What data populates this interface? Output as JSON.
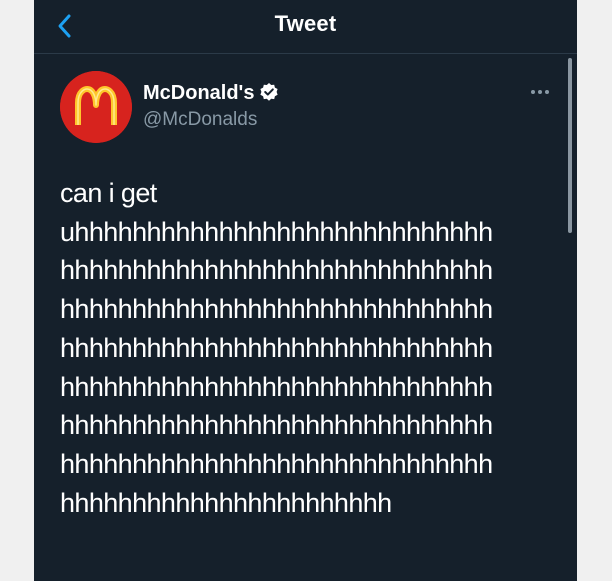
{
  "nav": {
    "title": "Tweet",
    "back_icon": "chevron-left-icon"
  },
  "colors": {
    "background": "#15202b",
    "accent": "#1da1f2",
    "brand_red": "#d7231e",
    "brand_gold": "#ffc72c"
  },
  "tweet": {
    "author_name": "McDonald's",
    "author_handle": "@McDonalds",
    "verified_icon": "verified-badge-icon",
    "more_icon": "more-dots-icon",
    "avatar_icon": "mcdonalds-logo-icon",
    "text": "can i get\nuhhhhhhhhhhhhhhhhhhhhhhhhhhhhh\nhhhhhhhhhhhhhhhhhhhhhhhhhhhhhh\nhhhhhhhhhhhhhhhhhhhhhhhhhhhhhh\nhhhhhhhhhhhhhhhhhhhhhhhhhhhhhh\nhhhhhhhhhhhhhhhhhhhhhhhhhhhhhh\nhhhhhhhhhhhhhhhhhhhhhhhhhhhhhh\nhhhhhhhhhhhhhhhhhhhhhhhhhhhhhh\nhhhhhhhhhhhhhhhhhhhhhhh"
  }
}
